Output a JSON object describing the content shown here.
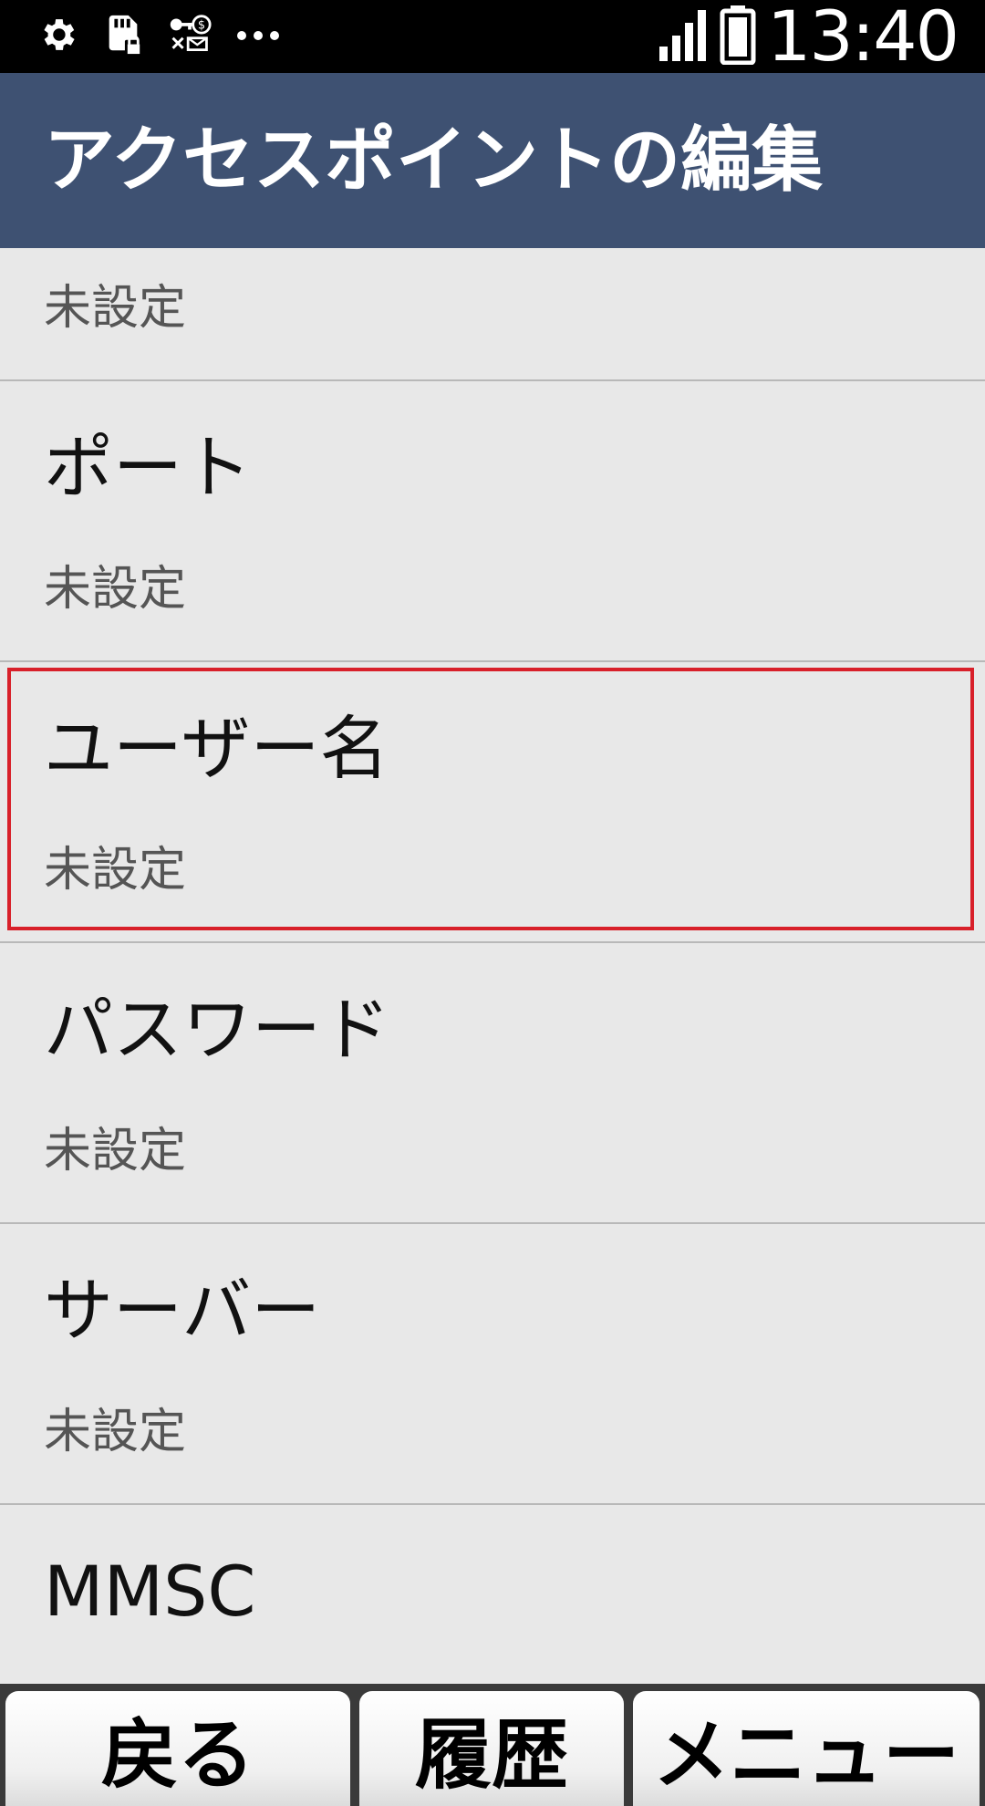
{
  "status_bar": {
    "time": "13:40",
    "icons": [
      "gear-icon",
      "sd-card-lock-icon",
      "key-mail-icon",
      "more-icon",
      "signal-icon",
      "battery-icon"
    ]
  },
  "header": {
    "title": "アクセスポイントの編集"
  },
  "settings": {
    "items": [
      {
        "label": "",
        "value": "未設定"
      },
      {
        "label": "ポート",
        "value": "未設定"
      },
      {
        "label": "ユーザー名",
        "value": "未設定"
      },
      {
        "label": "パスワード",
        "value": "未設定"
      },
      {
        "label": "サーバー",
        "value": "未設定"
      },
      {
        "label": "MMSC",
        "value": ""
      }
    ],
    "focused_index": 2
  },
  "softkeys": {
    "back": "戻る",
    "history": "履歴",
    "menu": "メニュー"
  },
  "colors": {
    "title_bar": "#3e5172",
    "focus_ring": "#d8202a",
    "background": "#e8e8e8"
  }
}
